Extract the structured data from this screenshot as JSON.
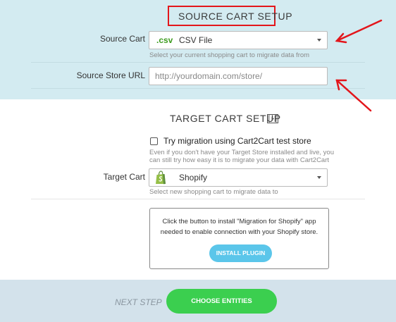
{
  "source": {
    "title": "SOURCE CART SETUP",
    "cart_label": "Source Cart",
    "cart_badge": ".csv",
    "cart_value": "CSV File",
    "cart_hint": "Select your current shopping cart to migrate data from",
    "url_label": "Source Store URL",
    "url_placeholder": "http://yourdomain.com/store/",
    "url_value": ""
  },
  "target": {
    "title": "TARGET CART SETUP",
    "test_store_label": "Try migration using Cart2Cart test store",
    "test_store_checked": false,
    "test_store_hint_1": "Even if you don't have your Target Store installed and live, you",
    "test_store_hint_2": "can still try how easy it is to migrate your data with Cart2Cart",
    "cart_label": "Target Cart",
    "cart_value": "Shopify",
    "cart_hint": "Select new shopping cart to migrate data to",
    "plugin_text_1": "Click the button to install \"Migration for Shopify\" app",
    "plugin_text_2": "needed to enable connection with your Shopify store.",
    "install_button": "INSTALL PLUGIN"
  },
  "footer": {
    "next_step": "NEXT STEP",
    "choose_button": "CHOOSE ENTITIES"
  },
  "icons": {
    "video": "video-play-icon",
    "shopify": "shopify-bag-icon",
    "dropdown": "chevron-down-icon"
  },
  "colors": {
    "source_bg": "#d3ebf1",
    "footer_bg": "#d3e2eb",
    "highlight_box": "#e3161b",
    "annotation_arrow": "#e3161b",
    "csv_badge": "#3d9c1f",
    "install_button": "#5bc6ea",
    "choose_button": "#3bcf4f",
    "shopify_green": "#95bf47"
  }
}
